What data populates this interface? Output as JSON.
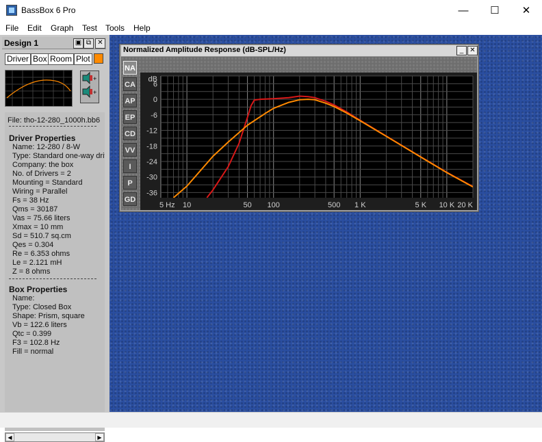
{
  "window": {
    "title": "BassBox 6 Pro",
    "minimize": "—",
    "maximize": "☐",
    "close": "✕"
  },
  "menu": [
    "File",
    "Edit",
    "Graph",
    "Test",
    "Tools",
    "Help"
  ],
  "design_panel": {
    "title": "Design 1",
    "tabs": [
      "Driver",
      "Box",
      "Room",
      "Plot"
    ],
    "plot_color": "#ff8a00",
    "file_label": "File:  tho-12-280_1000h.bb6",
    "driver_heading": "Driver Properties",
    "driver_props": [
      "Name:  12-280 / 8-W",
      "Type:  Standard one-way driv",
      "Company:  the box",
      "No. of Drivers = 2",
      "Mounting = Standard",
      "Wiring = Parallel",
      "Fs =  38 Hz",
      "Qms =  30187",
      "Vas =  75.66 liters",
      "Xmax =  10 mm",
      "Sd =  510.7 sq.cm",
      "Qes =  0.304",
      "Re =  6.353 ohms",
      "Le =  2.121 mH",
      "Z =  8 ohms"
    ],
    "box_heading": "Box Properties",
    "box_props": [
      "Name:",
      "Type:  Closed Box",
      "Shape:  Prism, square",
      "Vb =  122.6 liters",
      "Qtc =  0.399",
      "F3 =  102.8 Hz",
      "Fill = normal"
    ]
  },
  "graph_window": {
    "title": "Normalized Amplitude Response (dB-SPL/Hz)",
    "modes": [
      "NA",
      "CA",
      "AP",
      "EP",
      "CD",
      "VV",
      "I",
      "P",
      "GD"
    ],
    "active_mode": "NA"
  },
  "chart_data": {
    "type": "line",
    "title": "Normalized Amplitude Response (dB-SPL/Hz)",
    "x_scale": "log",
    "xlim": [
      5,
      20000
    ],
    "ylim": [
      -38,
      9
    ],
    "ylabel": "dB",
    "y_ticks": [
      6,
      0,
      -6,
      -12,
      -18,
      -24,
      -30,
      -36
    ],
    "x_ticks": [
      {
        "value": 5,
        "label": "5 Hz"
      },
      {
        "value": 10,
        "label": "10"
      },
      {
        "value": 50,
        "label": "50"
      },
      {
        "value": 100,
        "label": "100"
      },
      {
        "value": 500,
        "label": "500"
      },
      {
        "value": 1000,
        "label": "1 K"
      },
      {
        "value": 5000,
        "label": "5 K"
      },
      {
        "value": 10000,
        "label": "10 K"
      },
      {
        "value": 20000,
        "label": "20 K"
      }
    ],
    "grid": true,
    "series": [
      {
        "color": "#ff8a00",
        "x": [
          7,
          10,
          20,
          30,
          50,
          80,
          100,
          150,
          200,
          250,
          300,
          400,
          500,
          700,
          1000,
          2000,
          5000,
          10000,
          20000
        ],
        "y": [
          -38,
          -33.5,
          -22,
          -16.5,
          -10,
          -5.5,
          -3.5,
          -1.2,
          -0.2,
          0,
          -0.2,
          -1.5,
          -2.8,
          -5.3,
          -8.3,
          -14.3,
          -22.3,
          -28.3,
          -33.8
        ]
      },
      {
        "color": "#d81818",
        "x": [
          17,
          20,
          30,
          40,
          50,
          55,
          60,
          70,
          100,
          150,
          200,
          250,
          300,
          400,
          500,
          700,
          1000,
          2000,
          5000,
          10000,
          20000
        ],
        "y": [
          -38,
          -35,
          -26,
          -17,
          -7,
          -2.5,
          -0.3,
          0,
          0.2,
          0.6,
          1.2,
          1.0,
          0.6,
          -0.8,
          -2.2,
          -4.9,
          -8.1,
          -14.2,
          -22.2,
          -28.2,
          -33.7
        ]
      }
    ]
  }
}
